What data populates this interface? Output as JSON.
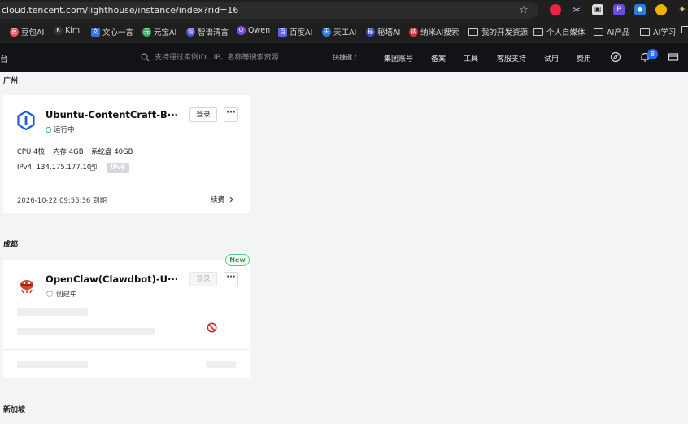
{
  "browser": {
    "url": "cloud.tencent.com/lighthouse/instance/index?rid=16"
  },
  "bookmarks": {
    "items": [
      {
        "label": "豆包AI",
        "color": "#e05a5a"
      },
      {
        "label": "Kimi",
        "color": "#222222"
      },
      {
        "label": "文心一言",
        "color": "#3b6fd8"
      },
      {
        "label": "元宝AI",
        "color": "#3fb06a"
      },
      {
        "label": "智谱清言",
        "color": "#4a55d8"
      },
      {
        "label": "Qwen",
        "color": "#7b4ce0"
      },
      {
        "label": "百度AI",
        "color": "#5b64e8"
      },
      {
        "label": "天工AI",
        "color": "#2f7bd6"
      },
      {
        "label": "秘塔AI",
        "color": "#3a4ec8"
      },
      {
        "label": "纳米AI搜索",
        "color": "#d33"
      },
      {
        "label": "我的开发资源",
        "color": ""
      },
      {
        "label": "个人自媒体",
        "color": ""
      },
      {
        "label": "AI产品",
        "color": ""
      },
      {
        "label": "AI学习",
        "color": ""
      }
    ]
  },
  "header": {
    "brand_fragment": "台",
    "search_placeholder": "支持通过实例ID、IP、名称等搜索资源",
    "shortcut": "快捷键 /",
    "nav": {
      "group_account": "集团账号",
      "filing": "备案",
      "tools": "工具",
      "support": "客服支持",
      "trial": "试用",
      "billing": "费用"
    },
    "notification_count": "8"
  },
  "regions": [
    {
      "name": "广州",
      "instance": {
        "title": "Ubuntu-ContentCraft-B···",
        "status": "运行中",
        "login_label": "登录",
        "more_label": "···",
        "cpu": "CPU 4核",
        "memory": "内存 4GB",
        "disk": "系统盘 40GB",
        "ipv4": "IPv4: 134.175.177.104",
        "ipv6_tag": "IPv6",
        "expire": "2026-10-22 09:55:36 到期",
        "renew": "续费"
      }
    },
    {
      "name": "成都",
      "instance": {
        "title": "OpenClaw(Clawdbot)-U···",
        "status": "创建中",
        "login_label": "登录",
        "more_label": "···",
        "new_tag": "New"
      }
    },
    {
      "name": "新加坡"
    }
  ],
  "colors": {
    "accent": "#2f6bff",
    "running": "#2fb36b",
    "header_bg": "#121316"
  }
}
